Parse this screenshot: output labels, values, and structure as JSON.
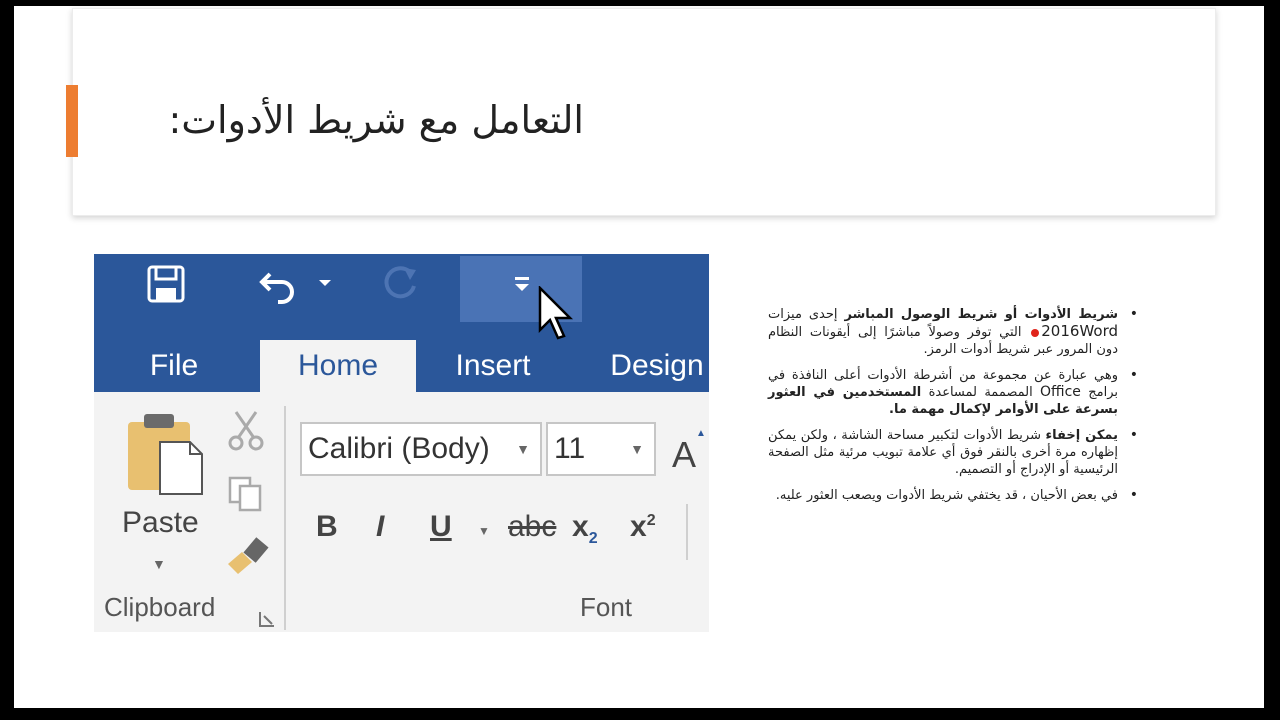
{
  "slide": {
    "title": "التعامل مع شريط الأدوات:",
    "accent_color": "#ed7d31"
  },
  "ribbon": {
    "theme_color": "#2b579a",
    "qat": {
      "save_icon": "save-icon",
      "undo_icon": "undo-icon",
      "redo_icon": "redo-icon",
      "customize_icon": "customize-qat-icon"
    },
    "tabs": [
      "File",
      "Home",
      "Insert",
      "Design"
    ],
    "active_tab": "Home",
    "clipboard": {
      "paste_label": "Paste",
      "group_label": "Clipboard"
    },
    "font": {
      "font_name": "Calibri (Body)",
      "font_size": "11",
      "grow_font": "A",
      "bold": "B",
      "italic": "I",
      "underline": "U",
      "strikethrough": "abc",
      "subscript_base": "x",
      "subscript_mark": "2",
      "superscript_base": "x",
      "superscript_mark": "2",
      "group_label": "Font"
    }
  },
  "bullets": [
    {
      "bold_lead": "شريط الأدوات أو شريط الوصول المباشر",
      "text_1": " إحدى ميزات ",
      "word_ref": "2016Word",
      "text_2": " التي توفر وصولاً مباشرًا إلى أيقونات النظام دون المرور عبر شريط أدوات الرمز."
    },
    {
      "text_1": "وهي عبارة عن مجموعة من أشرطة الأدوات أعلى النافذة في برامج ",
      "office_ref": "Office",
      "text_2": " المصممة لمساعدة ",
      "bold_tail": "المستخدمين في العثور بسرعة على الأوامر لإكمال مهمة ما."
    },
    {
      "bold_lead": "يمكن إخفاء",
      "text_1": " شريط الأدوات لتكبير مساحة الشاشة ، ولكن يمكن إظهاره مرة أخرى بالنقر فوق أي علامة تبويب مرئية مثل الصفحة الرئيسية أو الإدراج أو التصميم."
    },
    {
      "text_1": "في بعض الأحيان ، قد يختفي شريط الأدوات ويصعب العثور عليه."
    }
  ]
}
